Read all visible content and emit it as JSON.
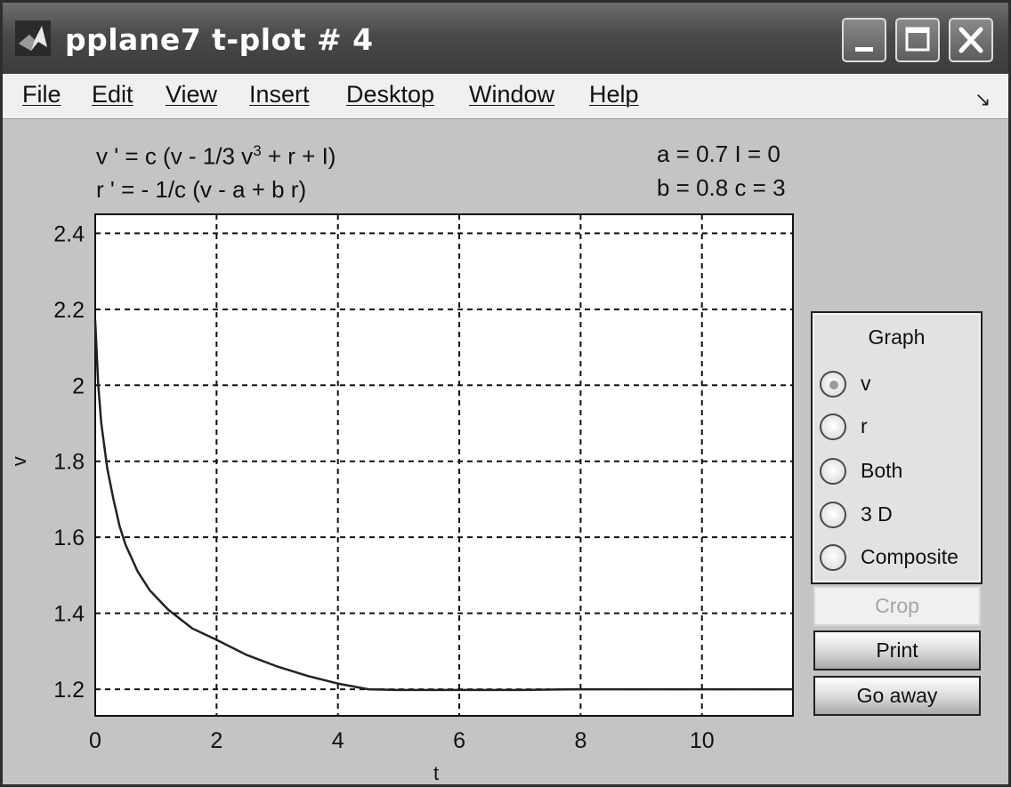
{
  "window": {
    "title": "pplane7 t-plot # 4"
  },
  "menu": {
    "items": [
      "File",
      "Edit",
      "View",
      "Insert",
      "Desktop",
      "Window",
      "Help"
    ]
  },
  "equations": {
    "line1_prefix": "v ' = c (v - 1/3 v",
    "line1_exp": "3",
    "line1_suffix": " + r + I)",
    "line2": "r ' = - 1/c (v - a + b r)"
  },
  "params": {
    "line1": "a = 0.7  I = 0",
    "line2": "b = 0.8  c = 3"
  },
  "graph_panel": {
    "title": "Graph",
    "options": [
      "v",
      "r",
      "Both",
      "3 D",
      "Composite"
    ],
    "selected": "v"
  },
  "buttons": {
    "crop": "Crop",
    "print": "Print",
    "go_away": "Go away"
  },
  "chart_data": {
    "type": "line",
    "xlabel": "t",
    "ylabel": "v",
    "xlim": [
      0,
      11.5
    ],
    "ylim": [
      1.13,
      2.45
    ],
    "xticks": [
      0,
      2,
      4,
      6,
      8,
      10
    ],
    "yticks": [
      1.2,
      1.4,
      1.6,
      1.8,
      2,
      2.2,
      2.4
    ],
    "grid": true,
    "grid_style": "dashed",
    "series": [
      {
        "x": [
          0,
          0.05,
          0.1,
          0.2,
          0.3,
          0.4,
          0.5,
          0.7,
          0.9,
          1.2,
          1.6,
          2.0,
          2.5,
          3.0,
          3.5,
          4.0,
          4.5,
          5.0,
          6.0,
          7.0,
          8.0,
          9.0,
          10.0,
          11.5
        ],
        "y": [
          2.17,
          2.0,
          1.9,
          1.78,
          1.7,
          1.63,
          1.58,
          1.51,
          1.46,
          1.41,
          1.36,
          1.33,
          1.29,
          1.26,
          1.235,
          1.215,
          1.2,
          1.198,
          1.198,
          1.198,
          1.2,
          1.2,
          1.2,
          1.2
        ]
      }
    ]
  }
}
